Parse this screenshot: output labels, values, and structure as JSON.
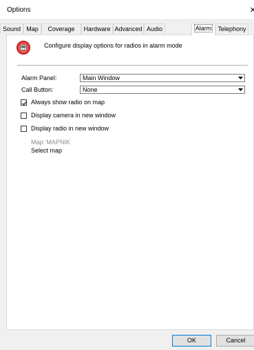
{
  "window": {
    "title": "Options",
    "close_glyph": "✕"
  },
  "tabs": [
    {
      "label": "Sound"
    },
    {
      "label": "Map"
    },
    {
      "label": "Coverage Map"
    },
    {
      "label": "Hardware"
    },
    {
      "label": "Advanced"
    },
    {
      "label": "Audio"
    },
    {
      "label": "Alarm"
    },
    {
      "label": "Telephony"
    }
  ],
  "active_tab": "Alarm",
  "panel": {
    "icon": "alarm-radio-icon",
    "heading": "Configure display options for radios in alarm mode",
    "alarm_panel": {
      "label": "Alarm Panel:",
      "value": "Main Window"
    },
    "call_button": {
      "label": "Call Button:",
      "value": "None"
    },
    "checkboxes": [
      {
        "label": "Always show radio on map",
        "checked": true
      },
      {
        "label": "Display camera in new window",
        "checked": false
      },
      {
        "label": "Display radio in new window",
        "checked": false
      }
    ],
    "map_label": "Map: MAPNIK",
    "select_map": "Select map"
  },
  "buttons": {
    "ok": "OK",
    "cancel": "Cancel"
  },
  "colors": {
    "accent": "#0078d7",
    "icon_red": "#e03030"
  }
}
